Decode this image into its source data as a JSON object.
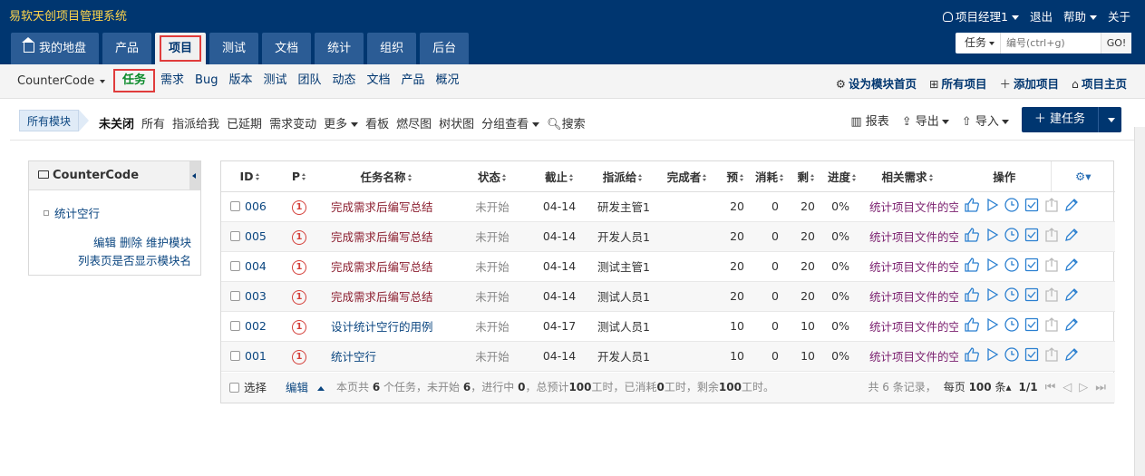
{
  "app": {
    "title": "易软天创项目管理系统"
  },
  "topbar": {
    "user": "项目经理1",
    "logout": "退出",
    "help": "帮助",
    "about": "关于"
  },
  "nav": {
    "tabs": [
      {
        "label": "我的地盘"
      },
      {
        "label": "产品"
      },
      {
        "label": "项目"
      },
      {
        "label": "测试"
      },
      {
        "label": "文档"
      },
      {
        "label": "统计"
      },
      {
        "label": "组织"
      },
      {
        "label": "后台"
      }
    ]
  },
  "search": {
    "type": "任务",
    "placeholder": "编号(ctrl+g)",
    "go": "GO!"
  },
  "subnav": {
    "project": "CounterCode",
    "items": [
      "任务",
      "需求",
      "Bug",
      "版本",
      "测试",
      "团队",
      "动态",
      "文档",
      "产品",
      "概况"
    ],
    "right": [
      "设为模块首页",
      "所有项目",
      "添加项目",
      "项目主页"
    ]
  },
  "featurebar": {
    "module": "所有模块",
    "filters": [
      "未关闭",
      "所有",
      "指派给我",
      "已延期",
      "需求变动",
      "更多",
      "看板",
      "燃尽图",
      "树状图",
      "分组查看",
      "搜索"
    ],
    "report": "报表",
    "export": "导出",
    "import": "导入",
    "create": "建任务"
  },
  "sidebar": {
    "title": "CounterCode",
    "module": "统计空行",
    "links": [
      "编辑",
      "删除",
      "维护模块"
    ],
    "link2": "列表页是否显示模块名"
  },
  "table": {
    "headers": {
      "id": "ID",
      "pri": "P",
      "name": "任务名称",
      "status": "状态",
      "deadline": "截止",
      "assigned": "指派给",
      "finished": "完成者",
      "estimate": "预",
      "consumed": "消耗",
      "left": "剩",
      "progress": "进度",
      "story": "相关需求",
      "actions": "操作"
    },
    "rows": [
      {
        "id": "006",
        "pri": "1",
        "name": "完成需求后编写总结",
        "status": "未开始",
        "deadline": "04-14",
        "assigned": "研发主管1",
        "finished": "",
        "estimate": "20",
        "consumed": "0",
        "left": "20",
        "progress": "0%",
        "story": "统计项目文件的空行"
      },
      {
        "id": "005",
        "pri": "1",
        "name": "完成需求后编写总结",
        "status": "未开始",
        "deadline": "04-14",
        "assigned": "开发人员1",
        "finished": "",
        "estimate": "20",
        "consumed": "0",
        "left": "20",
        "progress": "0%",
        "story": "统计项目文件的空行"
      },
      {
        "id": "004",
        "pri": "1",
        "name": "完成需求后编写总结",
        "status": "未开始",
        "deadline": "04-14",
        "assigned": "测试主管1",
        "finished": "",
        "estimate": "20",
        "consumed": "0",
        "left": "20",
        "progress": "0%",
        "story": "统计项目文件的空行"
      },
      {
        "id": "003",
        "pri": "1",
        "name": "完成需求后编写总结",
        "status": "未开始",
        "deadline": "04-14",
        "assigned": "测试人员1",
        "finished": "",
        "estimate": "20",
        "consumed": "0",
        "left": "20",
        "progress": "0%",
        "story": "统计项目文件的空行"
      },
      {
        "id": "002",
        "pri": "1",
        "name": "设计统计空行的用例",
        "status": "未开始",
        "deadline": "04-17",
        "assigned": "测试人员1",
        "finished": "",
        "estimate": "10",
        "consumed": "0",
        "left": "10",
        "progress": "0%",
        "story": "统计项目文件的空行"
      },
      {
        "id": "001",
        "pri": "1",
        "name": "统计空行",
        "status": "未开始",
        "deadline": "04-14",
        "assigned": "开发人员1",
        "finished": "",
        "estimate": "10",
        "consumed": "0",
        "left": "10",
        "progress": "0%",
        "story": "统计项目文件的空行"
      }
    ]
  },
  "footer": {
    "select": "选择",
    "edit": "编辑",
    "s1": "本页共",
    "count": "6",
    "s2": "个任务，未开始",
    "wait": "6",
    "s3": "，进行中",
    "doing": "0",
    "s4": "，总预计",
    "est": "100",
    "s5": "工时，已消耗",
    "cons": "0",
    "s6": "工时，剩余",
    "left": "100",
    "s7": "工时。",
    "records": "共 6 条记录，",
    "perpage_prefix": "每页",
    "perpage": "100",
    "perpage_suffix": "条",
    "page": "1/1"
  },
  "colors": {
    "header_bg": "#003670",
    "brand": "#ffd54a",
    "highlight": "#e03c3c"
  }
}
